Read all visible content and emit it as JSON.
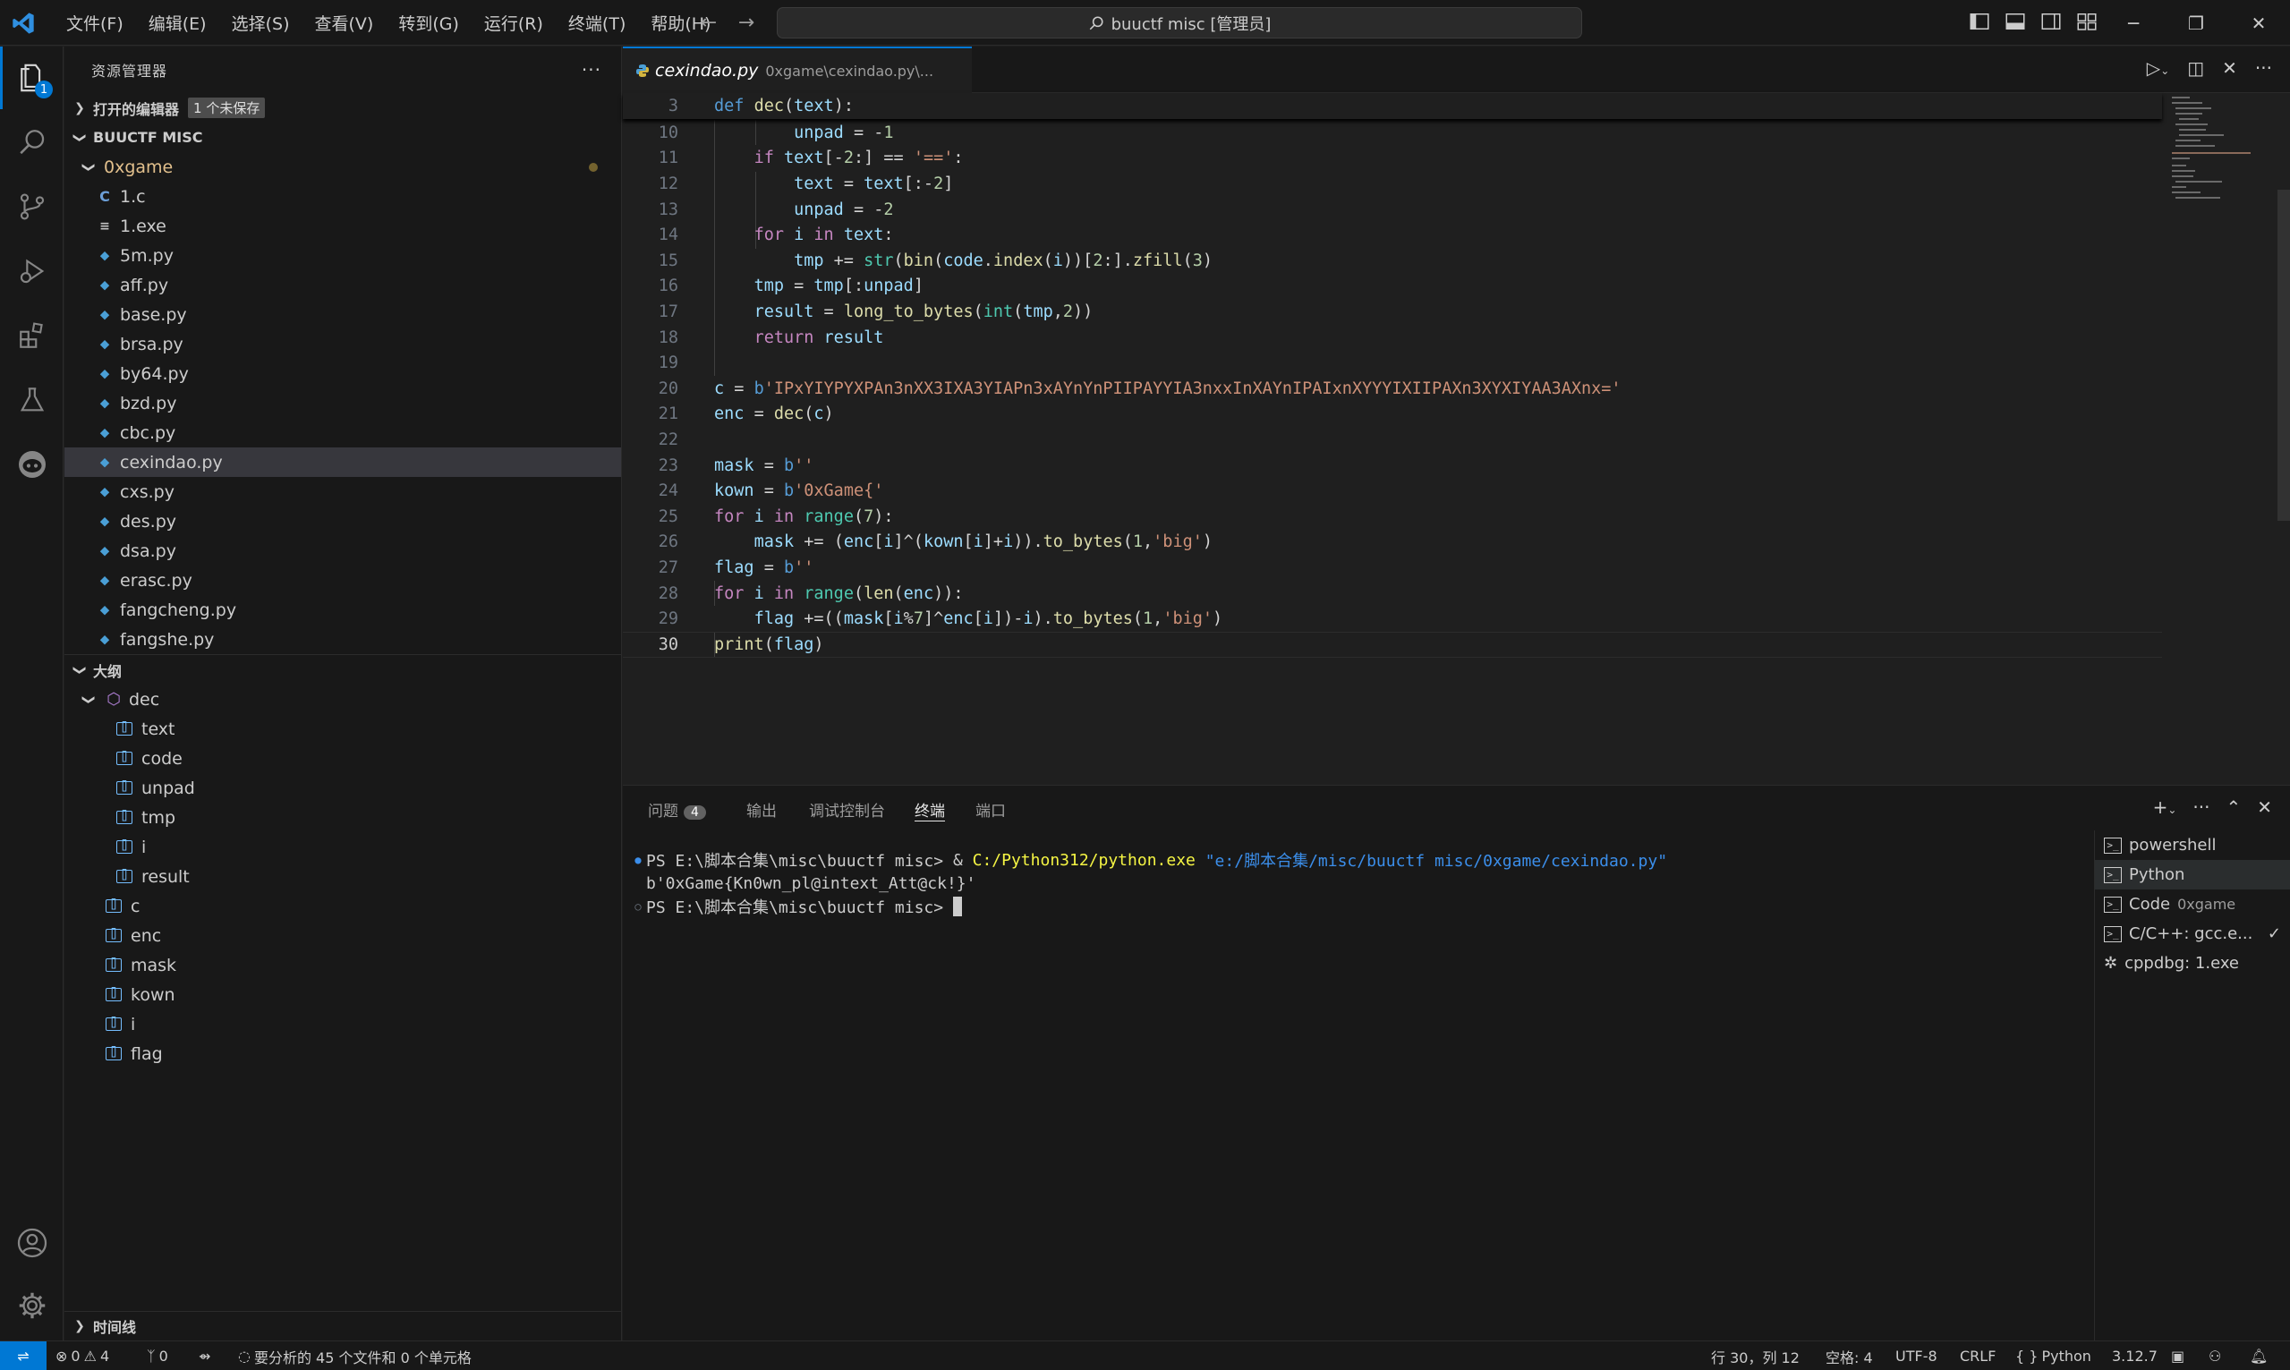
{
  "titlebar": {
    "menu": [
      "文件(F)",
      "编辑(E)",
      "选择(S)",
      "查看(V)",
      "转到(G)",
      "运行(R)",
      "终端(T)",
      "帮助(H)"
    ],
    "search": "buuctf misc [管理员]"
  },
  "activity": {
    "explorer_badge": "1"
  },
  "sidebar": {
    "title": "资源管理器",
    "open_editors": "打开的编辑器",
    "unsaved": "1 个未保存",
    "workspace": "BUUCTF MISC",
    "folder": "0xgame",
    "files": [
      {
        "name": "1.c",
        "icon": "C"
      },
      {
        "name": "1.exe",
        "icon": "≡"
      },
      {
        "name": "5m.py",
        "icon": "py"
      },
      {
        "name": "aff.py",
        "icon": "py"
      },
      {
        "name": "base.py",
        "icon": "py"
      },
      {
        "name": "brsa.py",
        "icon": "py"
      },
      {
        "name": "by64.py",
        "icon": "py"
      },
      {
        "name": "bzd.py",
        "icon": "py"
      },
      {
        "name": "cbc.py",
        "icon": "py"
      },
      {
        "name": "cexindao.py",
        "icon": "py"
      },
      {
        "name": "cxs.py",
        "icon": "py"
      },
      {
        "name": "des.py",
        "icon": "py"
      },
      {
        "name": "dsa.py",
        "icon": "py"
      },
      {
        "name": "erasc.py",
        "icon": "py"
      },
      {
        "name": "fangcheng.py",
        "icon": "py"
      },
      {
        "name": "fangshe.py",
        "icon": "py"
      }
    ],
    "outline": "大纲",
    "outline_fn": "dec",
    "outline_inner": [
      "text",
      "code",
      "unpad",
      "tmp",
      "i",
      "result"
    ],
    "outline_top": [
      "c",
      "enc",
      "mask",
      "kown",
      "i",
      "flag"
    ],
    "timeline": "时间线"
  },
  "editor": {
    "tab_name": "cexindao.py",
    "tab_path": "0xgame\\cexindao.py\\...",
    "sticky_ln": "3",
    "line_numbers": [
      "10",
      "11",
      "12",
      "13",
      "14",
      "15",
      "16",
      "17",
      "18",
      "19",
      "20",
      "21",
      "22",
      "23",
      "24",
      "25",
      "26",
      "27",
      "28",
      "29",
      "30"
    ]
  },
  "panel": {
    "tabs": [
      "问题",
      "输出",
      "调试控制台",
      "终端",
      "端口"
    ],
    "problems_count": "4",
    "term_prompt": "PS E:\\脚本合集\\misc\\buuctf misc> ",
    "term_amp": "& ",
    "term_exe": "C:/Python312/python.exe",
    "term_arg": "\"e:/脚本合集/misc/buuctf misc/0xgame/cexindao.py\"",
    "term_output": "b'0xGame{Kn0wn_pl@intext_Att@ck!}'",
    "terminals": [
      {
        "name": "powershell",
        "sub": ""
      },
      {
        "name": "Python",
        "sub": ""
      },
      {
        "name": "Code",
        "sub": "0xgame"
      },
      {
        "name": "C/C++: gcc.e...",
        "sub": ""
      },
      {
        "name": "cppdbg: 1.exe",
        "sub": ""
      }
    ]
  },
  "status": {
    "errors": "0",
    "warnings": "4",
    "ports": "0",
    "analysis": "要分析的 45 个文件和 0 个单元格",
    "position": "行 30，列 12",
    "spaces": "空格: 4",
    "encoding": "UTF-8",
    "eol": "CRLF",
    "language": "Python",
    "version": "3.12.7"
  },
  "colors": {
    "accent": "#0078d4",
    "background": "#1f1f1f",
    "sidebar": "#181818"
  }
}
